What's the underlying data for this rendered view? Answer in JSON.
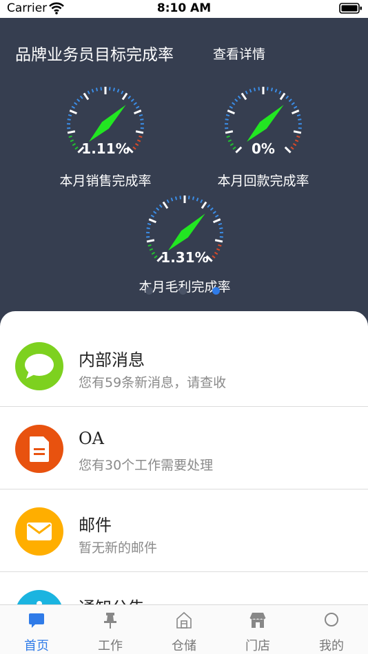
{
  "status_bar": {
    "carrier": "Carrier",
    "time": "8:10 AM"
  },
  "dashboard": {
    "title": "品牌业务员目标完成率",
    "detail_link": "查看详情",
    "gauges": [
      {
        "value_text": "1.11%",
        "label": "本月销售完成率",
        "percent": 1.11
      },
      {
        "value_text": "0%",
        "label": "本月回款完成率",
        "percent": 0
      },
      {
        "value_text": "1.31%",
        "label": "本月毛利完成率",
        "percent": 1.31
      }
    ],
    "pager": {
      "count": 3,
      "active_index": 2
    }
  },
  "colors": {
    "dashboard_bg": "#363e50",
    "needle": "#22e622",
    "tick_white": "#ffffff",
    "tick_blue": "#3b8ee8",
    "tick_green": "#22c030",
    "tick_red": "#d84a28",
    "pager_active": "#2f7be8",
    "tab_active": "#2f7be8"
  },
  "messages": [
    {
      "title": "内部消息",
      "subtitle": "您有59条新消息，请查收",
      "icon": "chat-bubble-icon",
      "color": "#7dd11f"
    },
    {
      "title": "OA",
      "subtitle": "您有30个工作需要处理",
      "icon": "document-icon",
      "color": "#e8520f"
    },
    {
      "title": "邮件",
      "subtitle": "暂无新的邮件",
      "icon": "mail-icon",
      "color": "#ffae00"
    },
    {
      "title": "通知公告",
      "subtitle": "",
      "icon": "info-icon",
      "color": "#1bb4e0"
    }
  ],
  "tabs": [
    {
      "label": "首页",
      "icon": "home-chat-icon",
      "active": true
    },
    {
      "label": "工作",
      "icon": "pin-icon",
      "active": false
    },
    {
      "label": "仓储",
      "icon": "warehouse-icon",
      "active": false
    },
    {
      "label": "门店",
      "icon": "store-icon",
      "active": false
    },
    {
      "label": "我的",
      "icon": "profile-circle-icon",
      "active": false
    }
  ]
}
